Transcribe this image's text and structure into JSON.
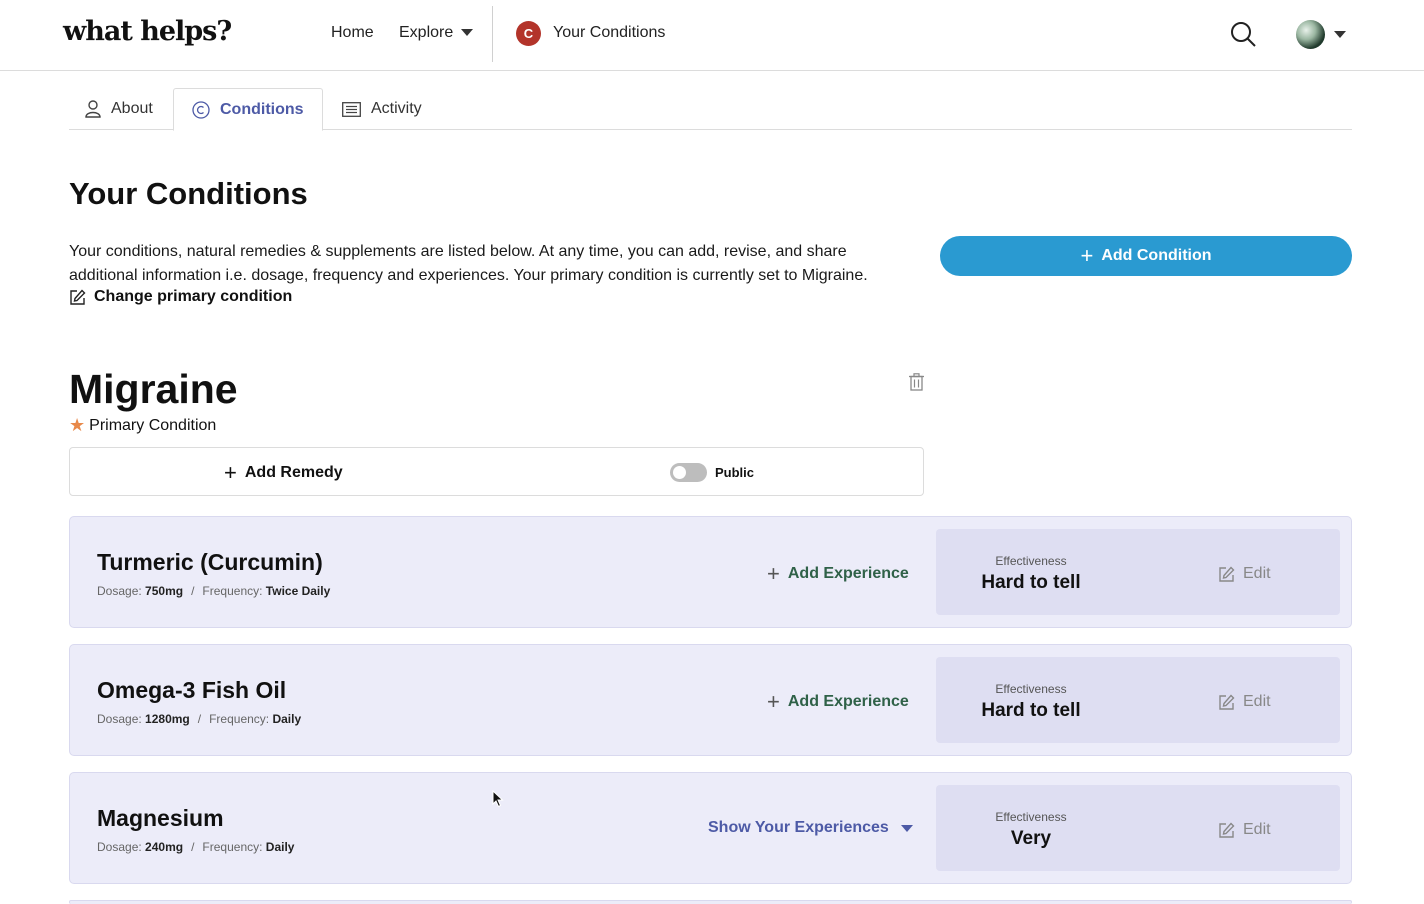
{
  "header": {
    "logo": "what helps?",
    "nav": {
      "home": "Home",
      "explore": "Explore",
      "conditions_badge": "C",
      "conditions": "Your Conditions"
    }
  },
  "tabs": {
    "about": "About",
    "conditions": "Conditions",
    "activity": "Activity"
  },
  "page": {
    "title": "Your Conditions",
    "intro": "Your conditions, natural remedies & supplements are listed below. At any time, you can add, revise, and share additional information i.e. dosage, frequency and experiences. Your primary condition is currently set to Migraine.",
    "change_primary": "Change primary condition",
    "add_condition": "Add Condition"
  },
  "condition": {
    "name": "Migraine",
    "primary_label": "Primary Condition",
    "add_remedy": "Add Remedy",
    "public_label": "Public",
    "public_on": false
  },
  "remedies": [
    {
      "name": "Turmeric (Curcumin)",
      "dosage_label": "Dosage:",
      "dosage": "750mg",
      "sep": "/",
      "frequency_label": "Frequency:",
      "frequency": "Twice Daily",
      "action": "Add Experience",
      "eff_label": "Effectiveness",
      "effectiveness": "Hard to tell",
      "edit": "Edit"
    },
    {
      "name": "Omega-3 Fish Oil",
      "dosage_label": "Dosage:",
      "dosage": "1280mg",
      "sep": "/",
      "frequency_label": "Frequency:",
      "frequency": "Daily",
      "action": "Add Experience",
      "eff_label": "Effectiveness",
      "effectiveness": "Hard to tell",
      "edit": "Edit"
    },
    {
      "name": "Magnesium",
      "dosage_label": "Dosage:",
      "dosage": "240mg",
      "sep": "/",
      "frequency_label": "Frequency:",
      "frequency": "Daily",
      "action": "Show Your Experiences",
      "eff_label": "Effectiveness",
      "effectiveness": "Very",
      "edit": "Edit"
    }
  ],
  "colors": {
    "accent_blue": "#2a9ad1",
    "tab_active": "#4d5aa6",
    "card_bg": "#ececf9",
    "badge": "#b3342a",
    "star": "#e8894a",
    "action_green": "#2f6148"
  },
  "icons": [
    "search-icon",
    "user-icon",
    "copyright-icon",
    "list-icon",
    "edit-icon",
    "trash-icon",
    "star-icon",
    "plus-icon",
    "chevron-down-icon"
  ]
}
